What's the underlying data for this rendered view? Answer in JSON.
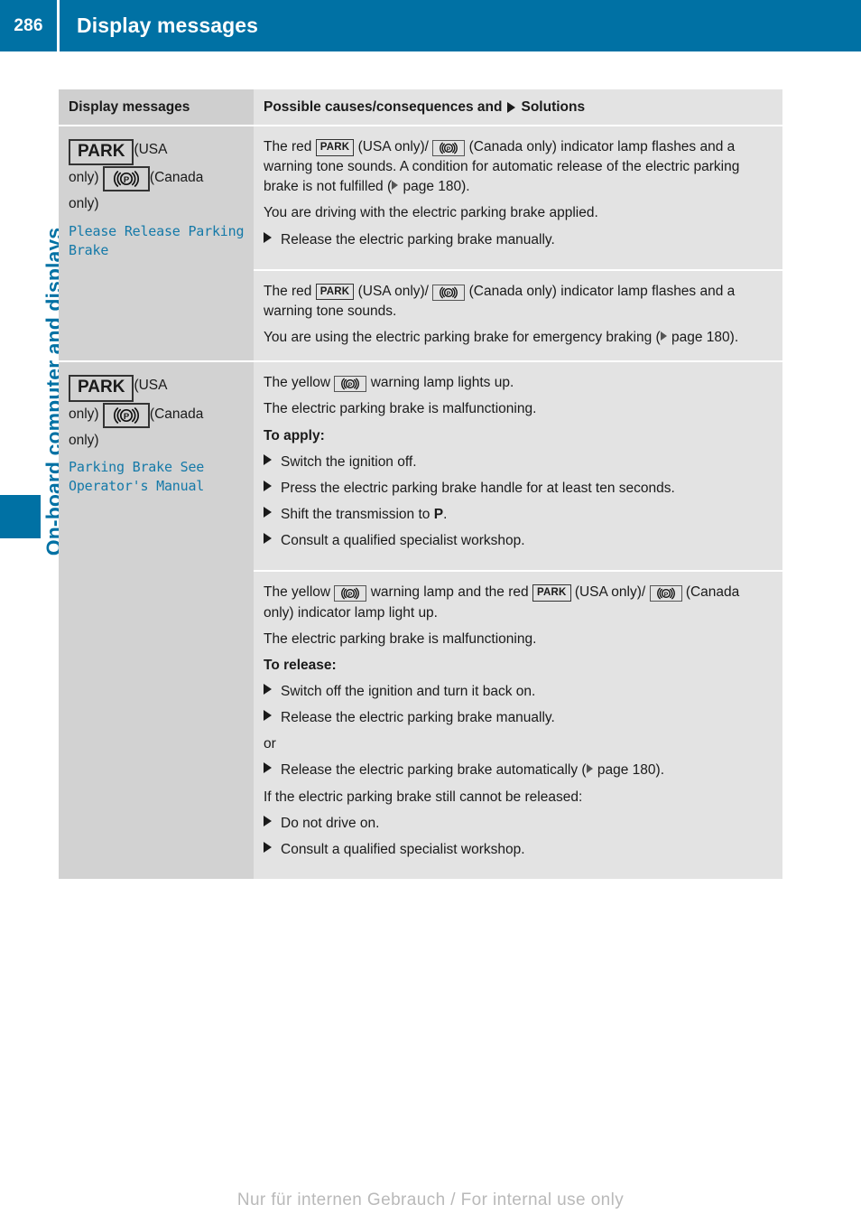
{
  "header": {
    "page_number": "286",
    "title": "Display messages"
  },
  "sidebar": {
    "chapter_label": "On-board computer and displays"
  },
  "table": {
    "columns": {
      "left_header": "Display messages",
      "right_header_part1": "Possible causes/consequences and",
      "right_header_part2": "Solutions"
    },
    "groups": [
      {
        "left": {
          "badge_park": "PARK",
          "usa_note": "(USA",
          "only_1": "only)",
          "canada_note": "(Canada",
          "only_2": "only)",
          "message": "Please Release Parking Brake"
        },
        "cells": [
          {
            "lines": [
              {
                "type": "rich",
                "parts": [
                  "The red ",
                  "[PARK]",
                  " (USA only)/",
                  "[PB]",
                  " (Canada only) indicator lamp flashes and a warning tone sounds. A condition for automatic release of the electric parking brake is not fulfilled (",
                  "[REF]",
                  " page 180)."
                ]
              },
              {
                "type": "plain",
                "text": "You are driving with the electric parking brake applied."
              }
            ],
            "steps": [
              "Release the electric parking brake manually."
            ]
          },
          {
            "lines": [
              {
                "type": "rich",
                "parts": [
                  "The red ",
                  "[PARK]",
                  " (USA only)/",
                  "[PB]",
                  " (Canada only) indicator lamp flashes and a warning tone sounds."
                ]
              },
              {
                "type": "rich2",
                "parts": [
                  "You are using the electric parking brake for emergency braking (",
                  "[REF]",
                  " page 180)."
                ]
              }
            ],
            "steps": []
          }
        ]
      },
      {
        "left": {
          "badge_park": "PARK",
          "usa_note": "(USA",
          "only_1": "only)",
          "canada_note": "(Canada",
          "only_2": "only)",
          "message": "Parking Brake See Operator's Manual"
        },
        "cells": [
          {
            "lines": [
              {
                "type": "rich",
                "parts": [
                  "The yellow ",
                  "[PB]",
                  " warning lamp lights up."
                ]
              },
              {
                "type": "plain",
                "text": "The electric parking brake is malfunctioning."
              }
            ],
            "subhead": "To apply:",
            "steps": [
              "Switch the ignition off.",
              "Press the electric parking brake handle for at least ten seconds.",
              "Shift the transmission to P.",
              "Consult a qualified specialist workshop."
            ]
          },
          {
            "lines": [
              {
                "type": "rich",
                "parts": [
                  "The yellow ",
                  "[PB]",
                  " warning lamp and the red ",
                  "[PARK]",
                  " (USA only)/",
                  "[PB]",
                  " (Canada only) indicator lamp light up."
                ]
              },
              {
                "type": "plain",
                "text": "The electric parking brake is malfunctioning."
              }
            ],
            "subhead": "To release:",
            "steps": [
              "Switch off the ignition and turn it back on.",
              "Release the electric parking brake manually."
            ],
            "or_label": "or",
            "steps_after_or": [
              "Release the electric parking brake automatically ( page 180)."
            ],
            "condition_text": "If the electric parking brake still cannot be released:",
            "final_steps": [
              "Do not drive on.",
              "Consult a qualified specialist workshop."
            ]
          }
        ]
      }
    ]
  },
  "footer": {
    "watermark": "Nur für internen Gebrauch / For internal use only"
  },
  "colors": {
    "brand_blue": "#0071a4",
    "message_blue": "#1479a8",
    "header_left_gray": "#cfcfcf",
    "header_right_gray": "#e3e3e3",
    "cell_left_gray": "#d2d2d2",
    "cell_right_gray": "#e3e3e3"
  }
}
